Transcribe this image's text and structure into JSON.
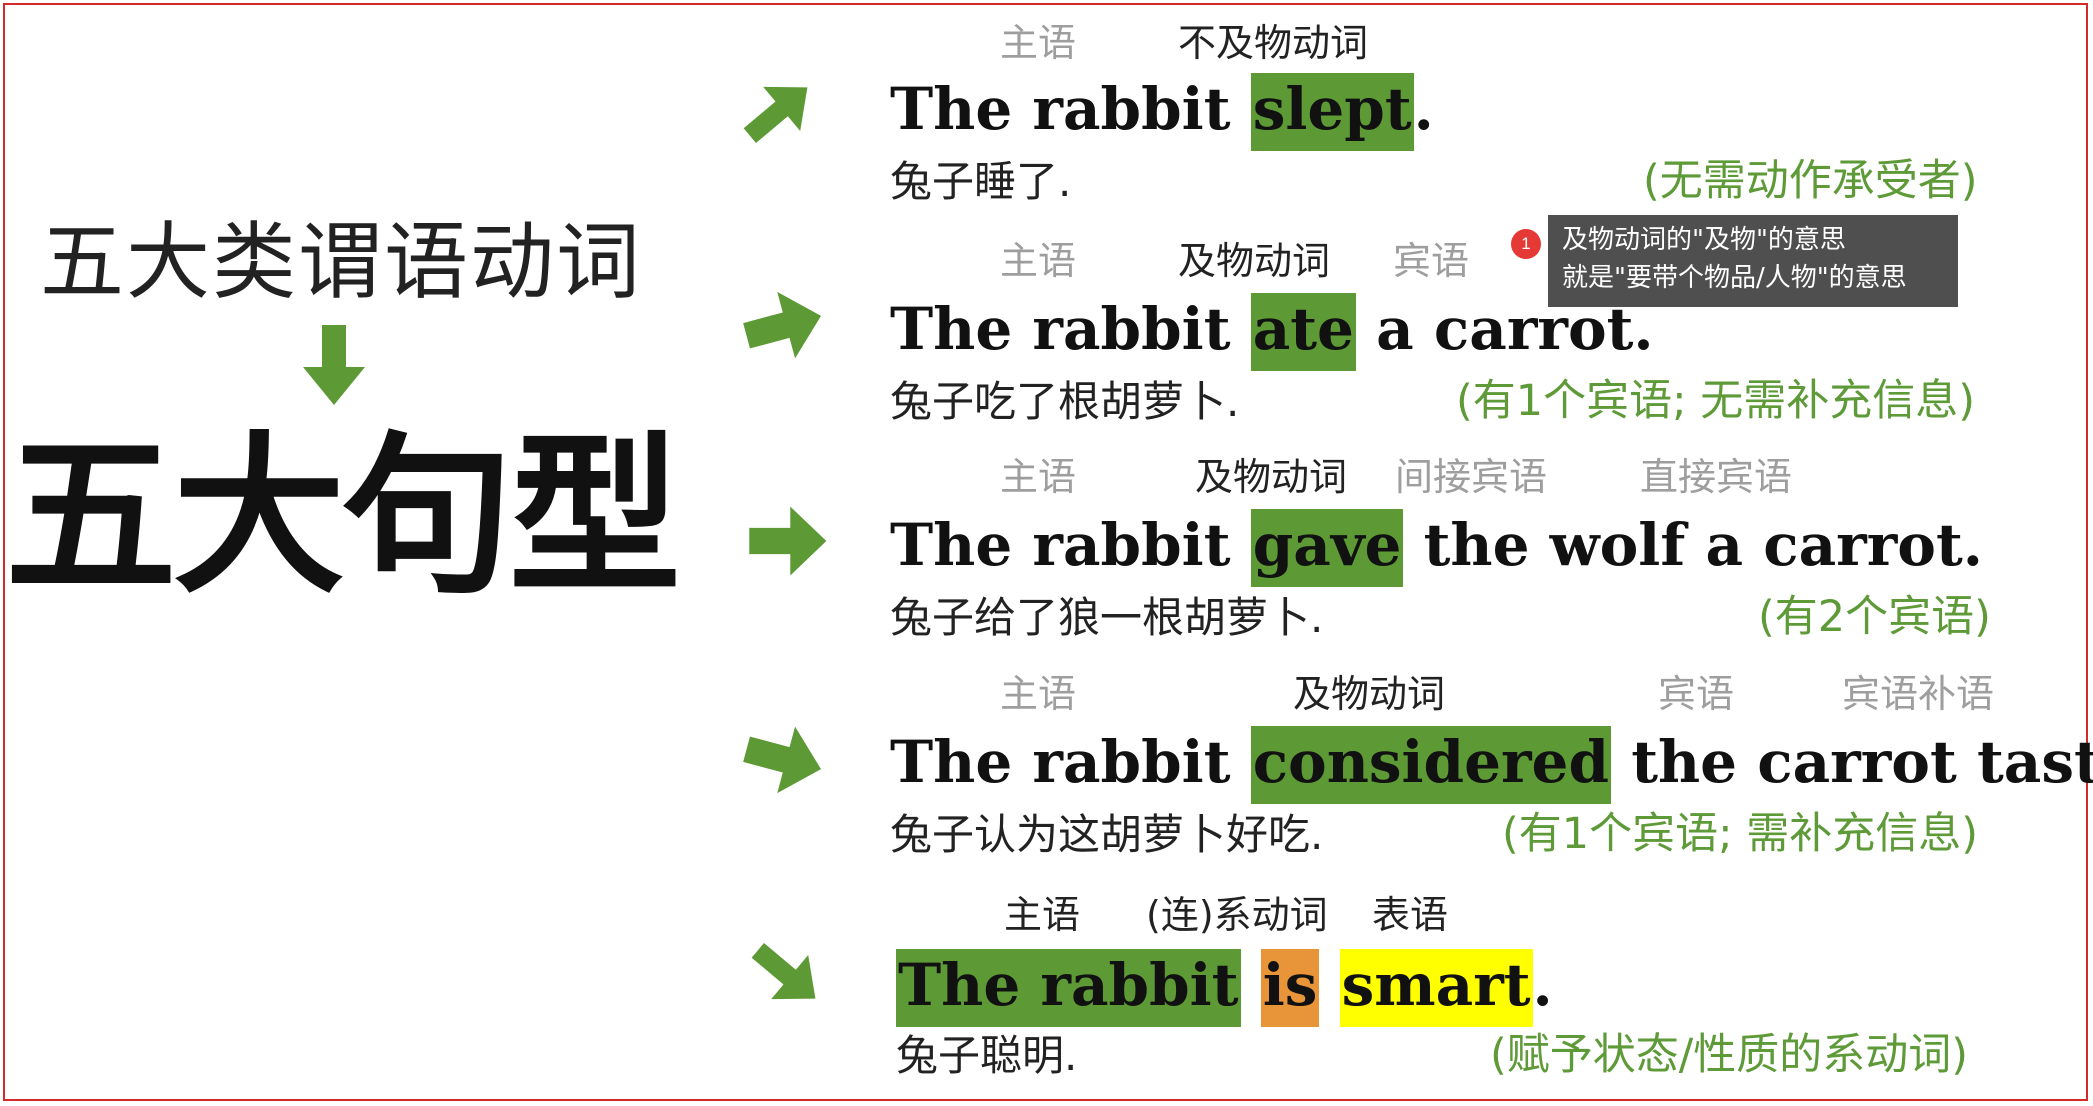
{
  "left": {
    "title": "五大类谓语动词",
    "big_title": "五大句型"
  },
  "tooltip": {
    "badge": "1",
    "line1": "及物动词的\"及物\"的意思",
    "line2": "就是\"要带个物品/人物\"的意思"
  },
  "rows": [
    {
      "labels": [
        "主语",
        "不及物动词"
      ],
      "sentence": {
        "pre": "The rabbit ",
        "verb": "slept",
        "post": "."
      },
      "chinese": "兔子睡了.",
      "note": "(无需动作承受者)"
    },
    {
      "labels": [
        "主语",
        "及物动词",
        "宾语"
      ],
      "sentence": {
        "pre": "The rabbit ",
        "verb": "ate",
        "post": " a carrot."
      },
      "chinese": "兔子吃了根胡萝卜.",
      "note": "(有1个宾语; 无需补充信息)"
    },
    {
      "labels": [
        "主语",
        "及物动词",
        "间接宾语",
        "直接宾语"
      ],
      "sentence": {
        "pre": "The rabbit ",
        "verb": "gave",
        "post": " the wolf a carrot."
      },
      "chinese": "兔子给了狼一根胡萝卜.",
      "note": "(有2个宾语)"
    },
    {
      "labels": [
        "主语",
        "及物动词",
        "宾语",
        "宾语补语"
      ],
      "sentence": {
        "pre": "The rabbit ",
        "verb": "considered",
        "post": " the carrot tasty."
      },
      "chinese": "兔子认为这胡萝卜好吃.",
      "note": "(有1个宾语; 需补充信息)"
    },
    {
      "labels": [
        "主语",
        "(连)系动词",
        "表语"
      ],
      "sentence": {
        "subject": "The rabbit",
        "verb": "is",
        "complement": "smart",
        "post": "."
      },
      "chinese": "兔子聪明.",
      "note": "(赋予状态/性质的系动词)"
    }
  ],
  "colors": {
    "green": "#5d9a35",
    "orange": "#e8953a",
    "yellow": "#ffff00",
    "note_green": "#5e9a38",
    "label_gray": "#9e9e9e",
    "frame_red": "#d42a2a"
  },
  "icons": [
    "arrow-down-icon",
    "arrow-up-right-icon",
    "arrow-right-icon",
    "arrow-down-right-icon"
  ]
}
